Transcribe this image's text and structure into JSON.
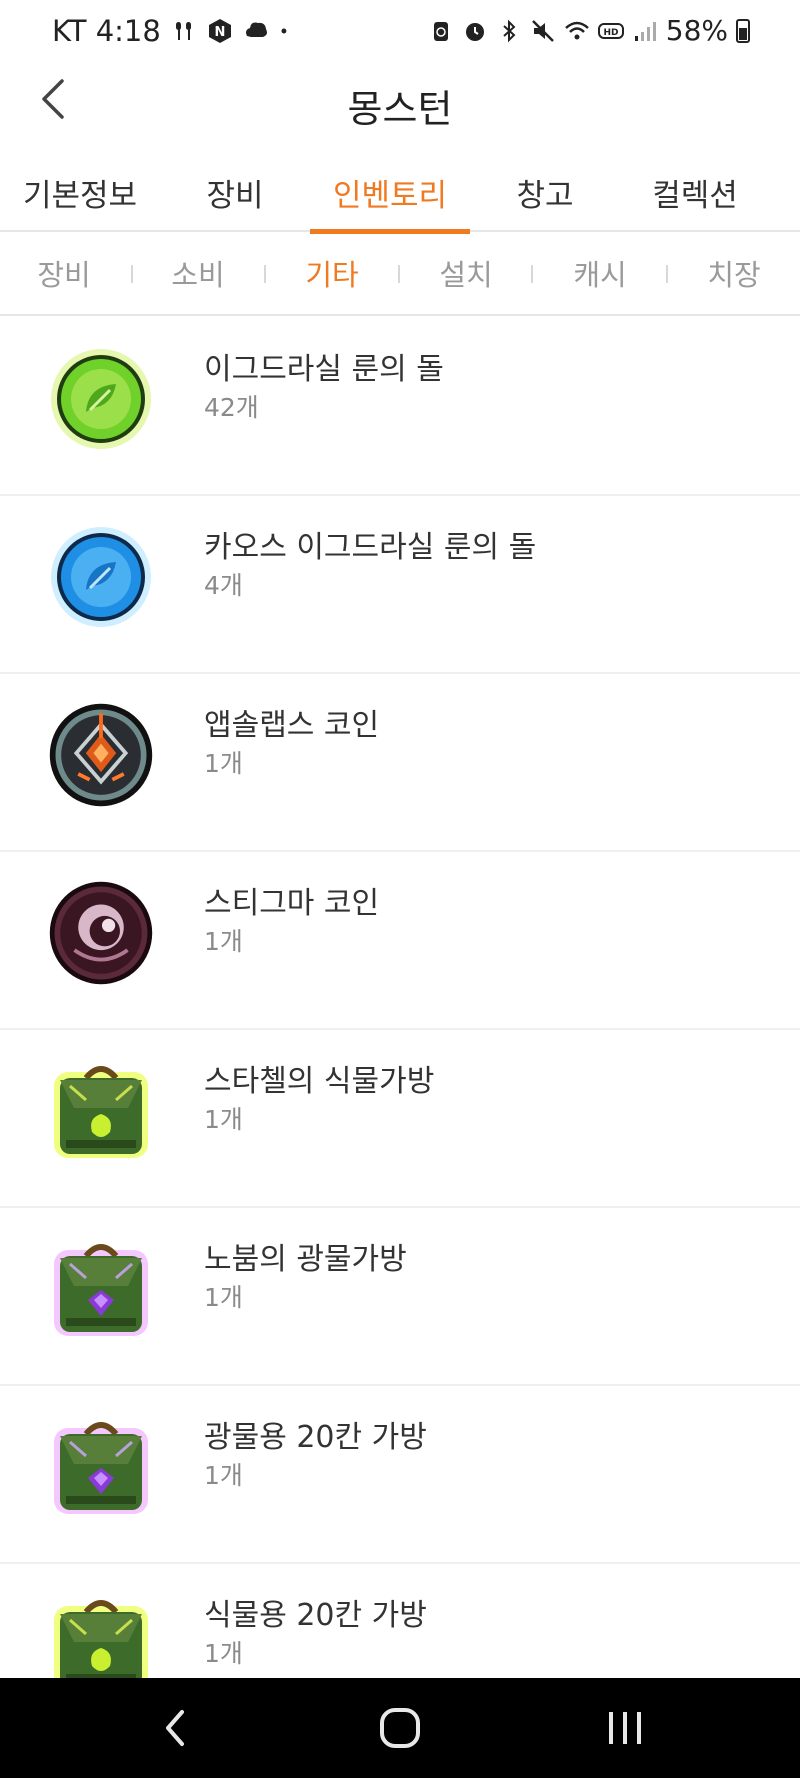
{
  "status_bar": {
    "carrier_time": "KT 4:18",
    "battery_percent": "58%",
    "left_icons": [
      "earbuds-icon",
      "naver-icon",
      "cloud-icon",
      "dot-icon"
    ],
    "right_icons": [
      "recycle-icon",
      "alarm-icon",
      "bluetooth-icon",
      "mute-icon",
      "wifi-icon",
      "hd-icon",
      "signal-icon",
      "battery-icon"
    ]
  },
  "header": {
    "title": "몽스턴",
    "back_icon": "chevron-left-icon"
  },
  "main_tabs": [
    {
      "label": "기본정보",
      "active": false
    },
    {
      "label": "장비",
      "active": false
    },
    {
      "label": "인벤토리",
      "active": true
    },
    {
      "label": "창고",
      "active": false
    },
    {
      "label": "컬렉션",
      "active": false
    }
  ],
  "sub_tabs": [
    {
      "label": "장비",
      "active": false
    },
    {
      "label": "소비",
      "active": false
    },
    {
      "label": "기타",
      "active": true
    },
    {
      "label": "설치",
      "active": false
    },
    {
      "label": "캐시",
      "active": false
    },
    {
      "label": "치장",
      "active": false
    }
  ],
  "items": [
    {
      "name": "이그드라실 룬의 돌",
      "count": "42개",
      "icon": "green-rune-stone-icon"
    },
    {
      "name": "카오스 이그드라실 룬의 돌",
      "count": "4개",
      "icon": "blue-rune-stone-icon"
    },
    {
      "name": "앱솔랩스 코인",
      "count": "1개",
      "icon": "absolab-coin-icon"
    },
    {
      "name": "스티그마 코인",
      "count": "1개",
      "icon": "stigma-coin-icon"
    },
    {
      "name": "스타첼의 식물가방",
      "count": "1개",
      "icon": "herb-bag-icon"
    },
    {
      "name": "노붐의 광물가방",
      "count": "1개",
      "icon": "mineral-bag-icon"
    },
    {
      "name": "광물용 20칸 가방",
      "count": "1개",
      "icon": "mineral-bag-20-icon"
    },
    {
      "name": "식물용 20칸 가방",
      "count": "1개",
      "icon": "herb-bag-20-icon"
    }
  ],
  "nav_bar": {
    "icons": [
      "nav-back-icon",
      "home-icon",
      "recent-apps-icon"
    ]
  },
  "colors": {
    "accent": "#f07a21",
    "inactive_subtab": "#9a9a9a",
    "divider": "#e6e6e6"
  }
}
